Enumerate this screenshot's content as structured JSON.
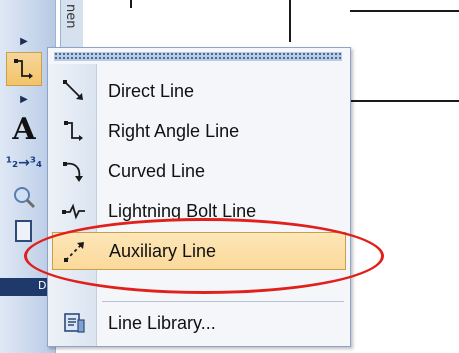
{
  "toolbar": {
    "strip_label": "nen",
    "bottom_label": "D"
  },
  "menu": {
    "items": [
      {
        "label": "Direct Line",
        "icon": "direct-line-icon"
      },
      {
        "label": "Right Angle Line",
        "icon": "right-angle-line-icon"
      },
      {
        "label": "Curved Line",
        "icon": "curved-line-icon"
      },
      {
        "label": "Lightning Bolt Line",
        "icon": "lightning-bolt-line-icon"
      },
      {
        "label": "Auxiliary Line",
        "icon": "auxiliary-line-icon",
        "highlighted": true
      },
      {
        "label": "Line Library...",
        "icon": "line-library-icon"
      }
    ]
  },
  "colors": {
    "highlight_ring": "#e0201b",
    "hover_bg": "#fbd99a",
    "toolbar_bg": "#c8d7ec"
  }
}
